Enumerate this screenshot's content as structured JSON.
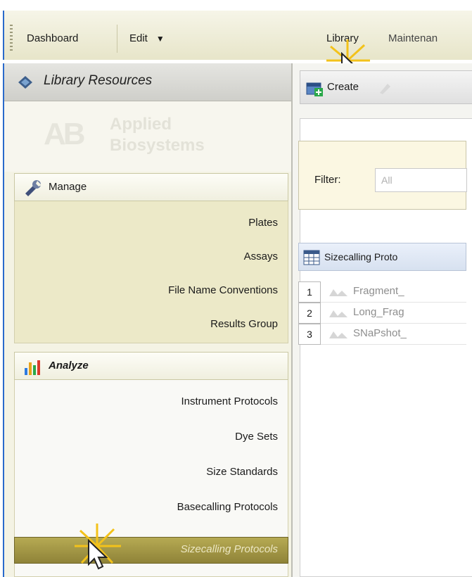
{
  "menubar": {
    "items": [
      {
        "label": "Dashboard"
      },
      {
        "label": "Edit"
      },
      {
        "label": "Library"
      },
      {
        "label": "Maintenan"
      }
    ]
  },
  "sidebar": {
    "title": "Library Resources",
    "logo": {
      "mark": "AB",
      "line1": "Applied",
      "line2": "Biosystems"
    },
    "manage": {
      "label": "Manage",
      "items": [
        "Plates",
        "Assays",
        "File Name Conventions",
        "Results Group"
      ]
    },
    "analyze": {
      "label": "Analyze",
      "items": [
        "Instrument Protocols",
        "Dye Sets",
        "Size Standards",
        "Basecalling Protocols",
        "Sizecalling Protocols"
      ],
      "active_index": 4
    }
  },
  "content": {
    "toolbar": {
      "create_label": "Create"
    },
    "filter": {
      "label": "Filter:",
      "value": "All"
    },
    "grid": {
      "header": "Sizecalling Proto",
      "rows": [
        {
          "num": "1",
          "name": "Fragment_"
        },
        {
          "num": "2",
          "name": "Long_Frag"
        },
        {
          "num": "3",
          "name": "SNaPshot_"
        }
      ]
    }
  },
  "colors": {
    "accent_blue": "#2a6acb",
    "active_nav": "#9d9140",
    "manage_bg": "#ece9c8"
  }
}
